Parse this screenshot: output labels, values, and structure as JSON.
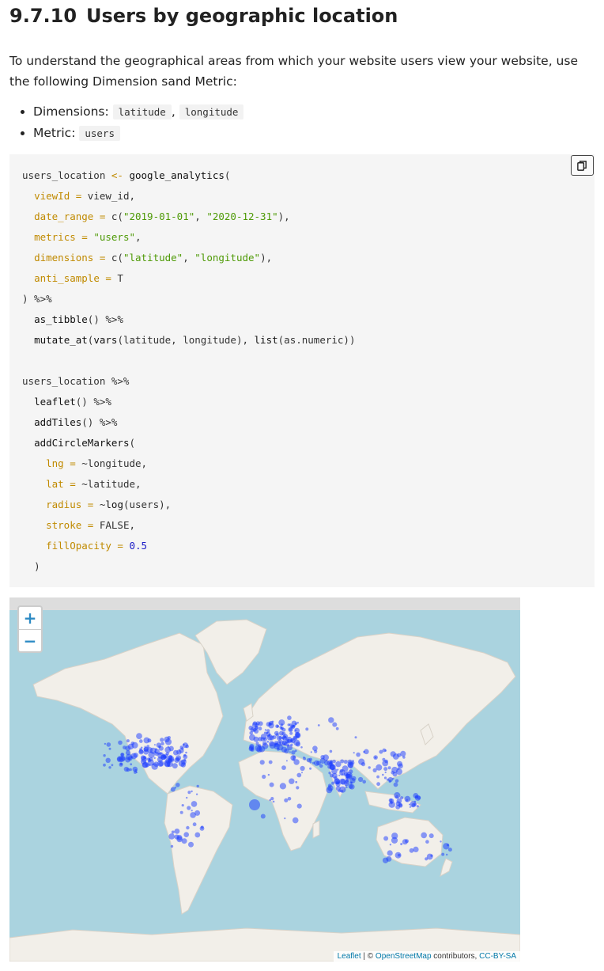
{
  "section": {
    "number": "9.7.10",
    "title": "Users by geographic location"
  },
  "intro": "To understand the geographical areas from which your website users view your website, use the following Dimension sand Metric:",
  "specs": {
    "dimensions_label": "Dimensions:",
    "dimension_1": "latitude",
    "dimension_sep": ",",
    "dimension_2": "longitude",
    "metric_label": "Metric:",
    "metric_1": "users"
  },
  "code": {
    "l1a": "users_location ",
    "l1op": "<-",
    "l1fn": " google_analytics",
    "l1c": "(",
    "l2k": "viewId =",
    "l2v": " view_id,",
    "l3k": "date_range =",
    "l3a": " c(",
    "l3s1": "\"2019-01-01\"",
    "l3b": ", ",
    "l3s2": "\"2020-12-31\"",
    "l3c": "),",
    "l4k": "metrics =",
    "l4s": " \"users\"",
    "l4c": ",",
    "l5k": "dimensions =",
    "l5a": " c(",
    "l5s1": "\"latitude\"",
    "l5b": ", ",
    "l5s2": "\"longitude\"",
    "l5c": "),",
    "l6k": "anti_sample =",
    "l6v": " T",
    "l7": ") %>%",
    "l8fn": "as_tibble",
    "l8c": "() %>%",
    "l9fn": "mutate_at",
    "l9a": "(",
    "l9fn2": "vars",
    "l9b": "(latitude, longitude), ",
    "l9fn3": "list",
    "l9c": "(as.numeric))",
    "l11": "users_location %>%",
    "l12fn": "leaflet",
    "l12c": "() %>%",
    "l13fn": "addTiles",
    "l13c": "() %>%",
    "l14fn": "addCircleMarkers",
    "l14c": "(",
    "l15k": "lng =",
    "l15v": " ~longitude,",
    "l16k": "lat =",
    "l16v": " ~latitude,",
    "l17k": "radius =",
    "l17a": " ~",
    "l17fn": "log",
    "l17c": "(users),",
    "l18k": "stroke =",
    "l18v": " FALSE,",
    "l19k": "fillOpacity =",
    "l19n": " 0.5",
    "l20": ")"
  },
  "map": {
    "zoom_in": "+",
    "zoom_out": "−",
    "attribution": {
      "leaflet": "Leaflet",
      "sep": " | © ",
      "osm": "OpenStreetMap",
      "contrib": " contributors, ",
      "license": "CC-BY-SA"
    },
    "colors": {
      "water": "#aad3df",
      "land": "#f2efe9",
      "marker": "#1a3cff"
    }
  }
}
